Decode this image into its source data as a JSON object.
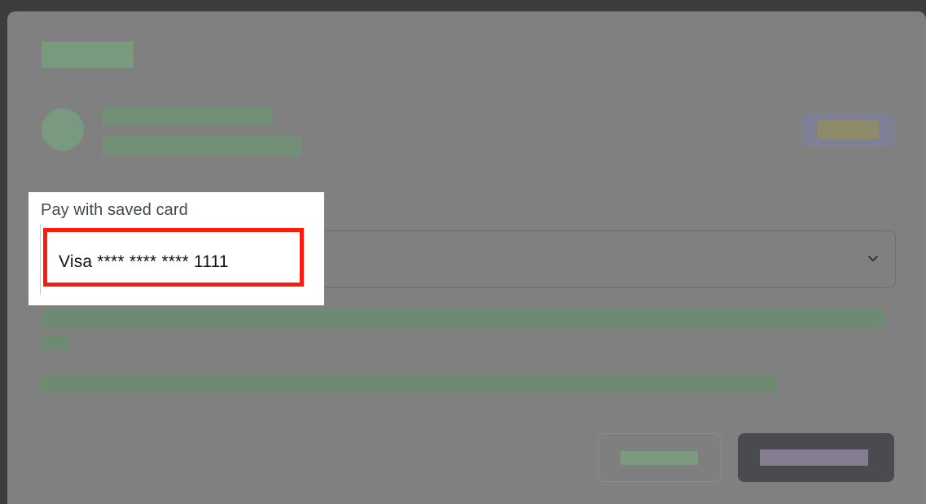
{
  "payment_field": {
    "label": "Pay with saved card",
    "selected_card": "Visa **** **** **** 1111",
    "dropdown_icon": "chevron-down-icon"
  },
  "colors": {
    "highlight": "#ff1a0e",
    "label_text": "#3f4a56",
    "submit_button": "#4a4b4f"
  }
}
